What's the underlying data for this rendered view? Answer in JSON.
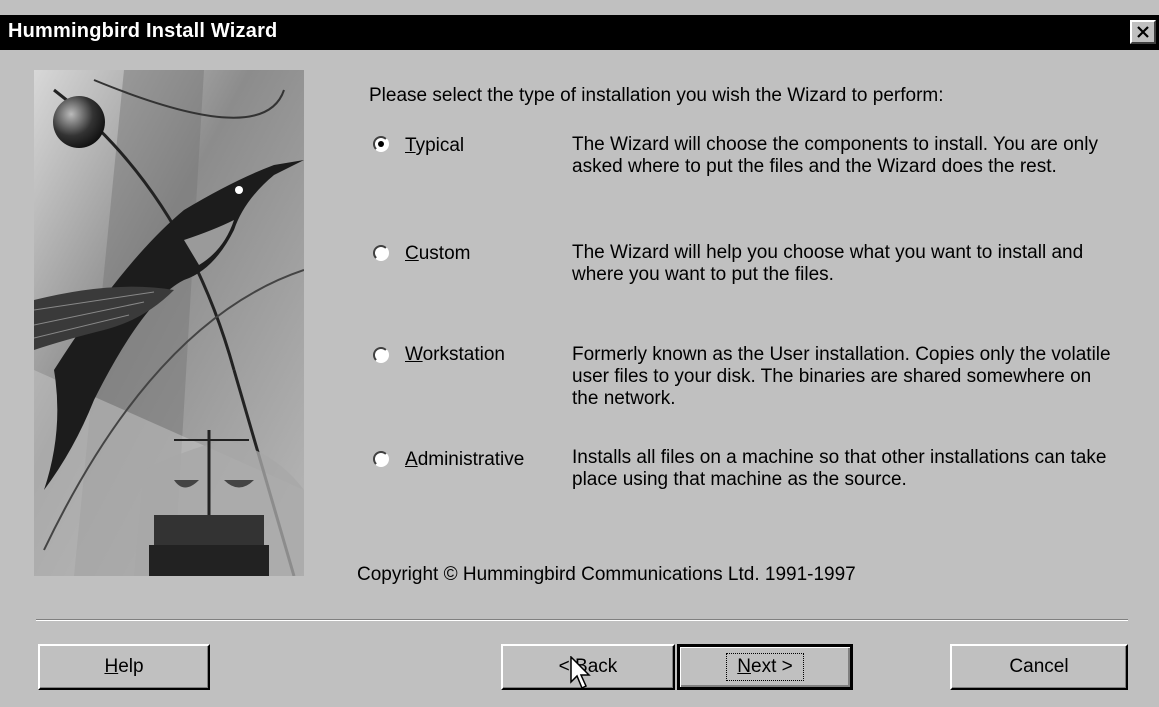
{
  "window": {
    "title": "Hummingbird Install Wizard",
    "close_icon": "close-icon"
  },
  "art": {
    "icon": "hummingbird-illustration"
  },
  "prompt": "Please select the type of installation you wish the Wizard to perform:",
  "options": [
    {
      "mnemonic": "T",
      "rest": "ypical",
      "selected": true,
      "desc": "The Wizard will choose the components to install. You are only asked where to put the files and the Wizard does the rest."
    },
    {
      "mnemonic": "C",
      "rest": "ustom",
      "selected": false,
      "desc": "The Wizard will help you choose what you want to install and where you want to put the files."
    },
    {
      "mnemonic": "W",
      "rest": "orkstation",
      "selected": false,
      "desc": "Formerly known as the User installation. Copies only the volatile user files to your disk. The binaries are shared somewhere on the network."
    },
    {
      "mnemonic": "A",
      "rest": "dministrative",
      "selected": false,
      "desc": "Installs all files on a machine so that other installations can take place using that machine as the source."
    }
  ],
  "copyright": "Copyright © Hummingbird Communications Ltd. 1991-1997",
  "buttons": {
    "help_mnemonic": "H",
    "help_rest": "elp",
    "back_prefix": "< ",
    "back_mnemonic": "B",
    "back_rest": "ack",
    "next_mnemonic": "N",
    "next_rest": "ext >",
    "cancel": "Cancel"
  }
}
